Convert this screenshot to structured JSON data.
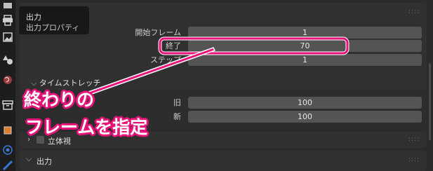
{
  "tooltip": {
    "title": "出力",
    "subtitle": "出力プロパティ"
  },
  "frame_range": {
    "start_label": "開始フレーム",
    "start_value": "1",
    "end_label": "終了",
    "end_value": "70",
    "step_label": "ステップ",
    "step_value": "1"
  },
  "time_stretch": {
    "header": "タイムストレッチ",
    "old_label": "旧",
    "old_value": "100",
    "new_label": "新",
    "new_value": "100"
  },
  "stereoscopy": {
    "header": "立体視"
  },
  "output": {
    "header": "出力"
  },
  "annotation": {
    "line1": "終わりの",
    "line2": "フレームを指定"
  },
  "colors": {
    "accent": "#e8137a",
    "panel": "#303030",
    "field": "#545454"
  },
  "toolbar_icons": [
    "printer-icon",
    "image-icon",
    "shapes-icon",
    "world-icon",
    "archive-icon",
    "object-icon",
    "physics-icon",
    "constraint-icon"
  ]
}
